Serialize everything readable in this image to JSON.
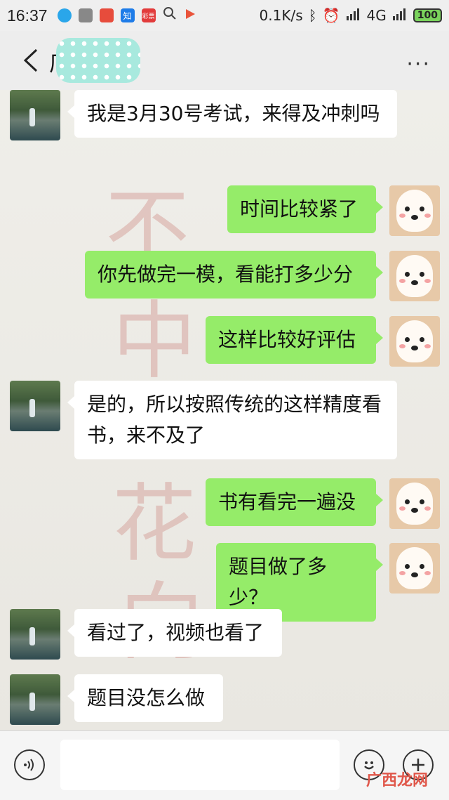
{
  "status_bar": {
    "time": "16:37",
    "network_speed": "0.1K/s",
    "network_type": "4G",
    "battery": "100",
    "app_icons": [
      "bird-app-icon",
      "wechat-icon",
      "weibo-icon",
      "zhihu-icon",
      "lottery-icon",
      "search-icon",
      "play-icon"
    ]
  },
  "header": {
    "title_visible_char": "厂",
    "more": "···"
  },
  "messages": [
    {
      "side": "in",
      "text": "我是3月30号考试，来得及冲刺吗"
    },
    {
      "side": "out",
      "text": "时间比较紧了"
    },
    {
      "side": "out",
      "text": "你先做完一模，看能打多少分"
    },
    {
      "side": "out",
      "text": "这样比较好评估"
    },
    {
      "side": "in",
      "text": "是的，所以按照传统的这样精度看书，来不及了"
    },
    {
      "side": "out",
      "text": "书有看完一遍没"
    },
    {
      "side": "out",
      "text": "题目做了多少？"
    },
    {
      "side": "in",
      "text": "看过了，视频也看了"
    },
    {
      "side": "in",
      "text": "题目没怎么做"
    }
  ],
  "input_bar": {
    "watermark": "广西龙网"
  },
  "colors": {
    "outgoing_bubble": "#95ec69",
    "incoming_bubble": "#ffffff"
  }
}
